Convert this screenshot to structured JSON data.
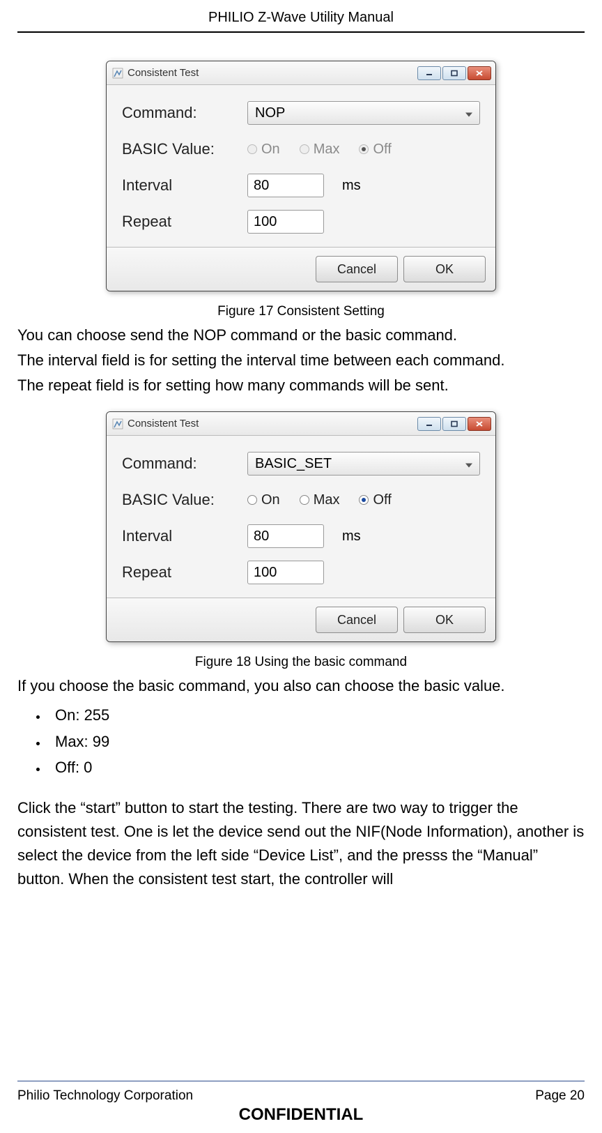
{
  "header": {
    "title": "PHILIO Z-Wave Utility Manual"
  },
  "dialog": {
    "title": "Consistent Test",
    "labels": {
      "command": "Command:",
      "basic_value": "BASIC Value:",
      "interval": "Interval",
      "repeat": "Repeat",
      "unit_ms": "ms"
    },
    "radios": {
      "on": "On",
      "max": "Max",
      "off": "Off"
    },
    "buttons": {
      "cancel": "Cancel",
      "ok": "OK"
    }
  },
  "figure17": {
    "caption": "Figure 17 Consistent Setting",
    "command_value": "NOP",
    "basic_selected": "Off",
    "basic_enabled": false,
    "interval_value": "80",
    "repeat_value": "100"
  },
  "para1": "You can choose send the NOP command or the basic command.",
  "para2": "The interval field is for setting the interval time between each command.",
  "para3": "The repeat field is for setting how many commands will be sent.",
  "figure18": {
    "caption": "Figure 18 Using the basic command",
    "command_value": "BASIC_SET",
    "basic_selected": "Off",
    "basic_enabled": true,
    "interval_value": "80",
    "repeat_value": "100"
  },
  "para4": "If you choose the basic command, you also can choose the basic value.",
  "bullets": [
    "On: 255",
    "Max: 99",
    "Off: 0"
  ],
  "para5": "Click the “start” button to start the testing. There are two way to trigger the consistent test.  One is let the device send out the NIF(Node Information), another is select the device from the left side “Device List”, and the presss the “Manual” button. When the consistent test start, the controller will",
  "footer": {
    "left": "Philio Technology Corporation",
    "right": "Page 20",
    "confidential": "CONFIDENTIAL"
  }
}
